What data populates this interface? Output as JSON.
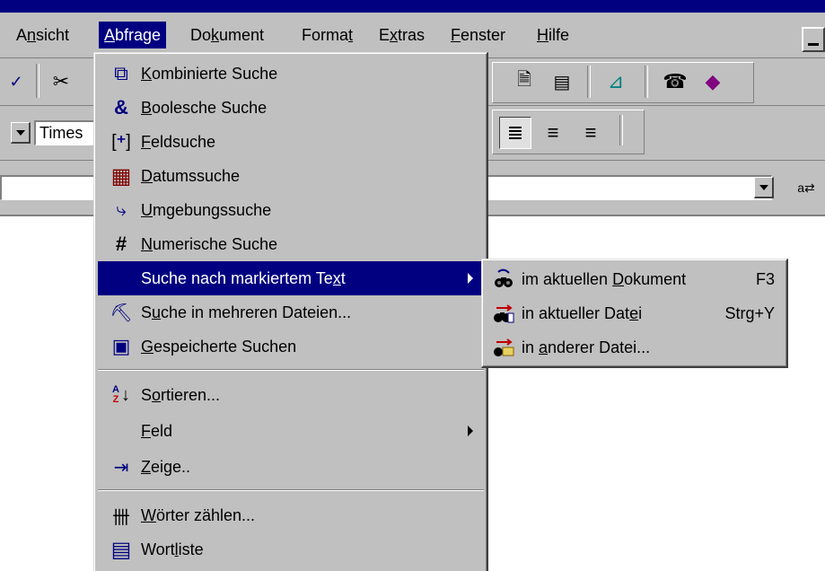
{
  "menubar": {
    "items": [
      {
        "pre": "A",
        "u": "n",
        "post": "sicht"
      },
      {
        "pre": "",
        "u": "A",
        "post": "bfrage"
      },
      {
        "pre": "Do",
        "u": "k",
        "post": "ument"
      },
      {
        "pre": "Forma",
        "u": "t",
        "post": ""
      },
      {
        "pre": "E",
        "u": "x",
        "post": "tras"
      },
      {
        "pre": "",
        "u": "F",
        "post": "enster"
      },
      {
        "pre": "",
        "u": "H",
        "post": "ilfe"
      }
    ]
  },
  "toolbar": {
    "font_name": "Times"
  },
  "menu": {
    "items": [
      {
        "icon": "combined-search-icon",
        "glyph": "⧉",
        "pre": "",
        "u": "K",
        "post": "ombinierte Suche"
      },
      {
        "icon": "ampersand-icon",
        "glyph": "&",
        "pre": "",
        "u": "B",
        "post": "oolesche Suche"
      },
      {
        "icon": "field-search-icon",
        "glyph": "⁺",
        "pre": "",
        "u": "F",
        "post": "eldsuche"
      },
      {
        "icon": "calendar-icon",
        "glyph": "▦",
        "pre": "",
        "u": "D",
        "post": "atumssuche"
      },
      {
        "icon": "proximity-icon",
        "glyph": "⤷",
        "pre": "",
        "u": "U",
        "post": "mgebungssuche"
      },
      {
        "icon": "hash-icon",
        "glyph": "#",
        "pre": "",
        "u": "N",
        "post": "umerische Suche"
      },
      {
        "icon": "",
        "glyph": "",
        "pre": "Suche nach markiertem Te",
        "u": "x",
        "post": "t"
      },
      {
        "icon": "binoculars-folder-icon",
        "glyph": "⛏",
        "pre": "S",
        "u": "u",
        "post": "che in mehreren Dateien..."
      },
      {
        "icon": "saved-searches-icon",
        "glyph": "▣",
        "pre": "",
        "u": "G",
        "post": "espeicherte Suchen"
      },
      {
        "icon": "sort-az-icon",
        "glyph": "↓",
        "pre": "S",
        "u": "o",
        "post": "rtieren..."
      },
      {
        "icon": "",
        "glyph": "",
        "pre": "",
        "u": "F",
        "post": "eld"
      },
      {
        "icon": "show-icon",
        "glyph": "⇥",
        "pre": "",
        "u": "Z",
        "post": "eige.."
      },
      {
        "icon": "word-count-icon",
        "glyph": "卌",
        "pre": "",
        "u": "W",
        "post": "örter zählen..."
      },
      {
        "icon": "word-list-icon",
        "glyph": "▤",
        "pre": "Wort",
        "u": "l",
        "post": "iste"
      }
    ]
  },
  "submenu": {
    "items": [
      {
        "icon": "binoculars-document-icon",
        "pre": "im aktuellen ",
        "u": "D",
        "post": "okument",
        "shortcut": "F3"
      },
      {
        "icon": "binoculars-file-icon",
        "pre": "in aktueller Dat",
        "u": "e",
        "post": "i",
        "shortcut": "Strg+Y"
      },
      {
        "icon": "binoculars-other-file-icon",
        "pre": "in ",
        "u": "a",
        "post": "nderer Datei...",
        "shortcut": ""
      }
    ]
  },
  "colors": {
    "menu_bg": "#c0c0c0",
    "highlight": "#000080",
    "titlebar": "#000080"
  }
}
